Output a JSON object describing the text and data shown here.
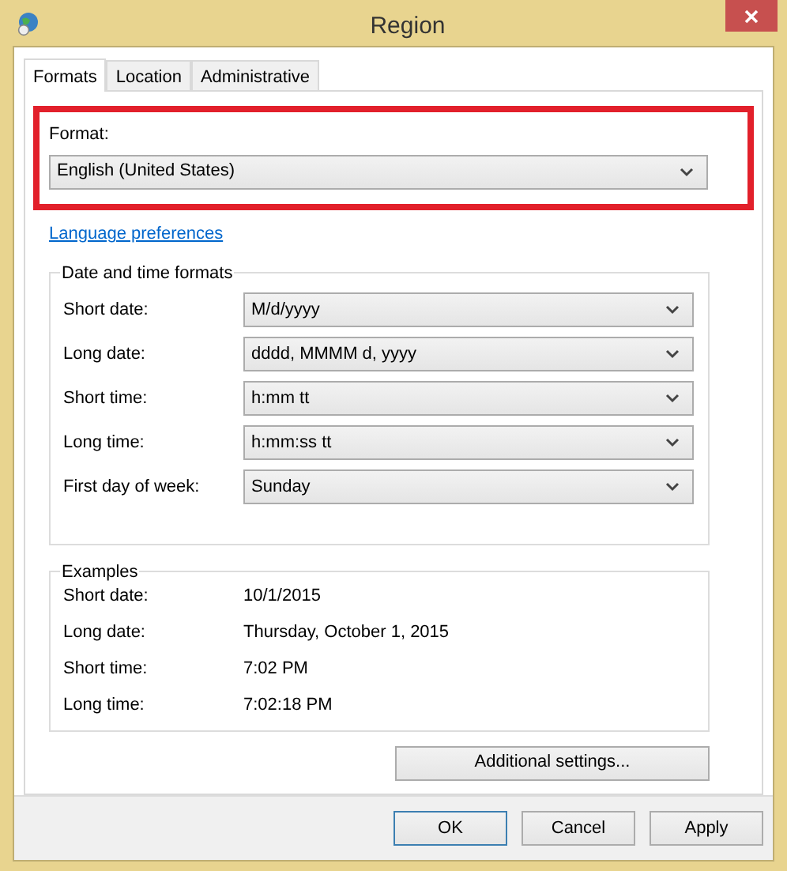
{
  "window": {
    "title": "Region"
  },
  "tabs": [
    {
      "label": "Formats",
      "selected": true
    },
    {
      "label": "Location",
      "selected": false
    },
    {
      "label": "Administrative",
      "selected": false
    }
  ],
  "format": {
    "label": "Format:",
    "value": "English (United States)"
  },
  "link": "Language preferences",
  "date_time_formats": {
    "title": "Date and time formats",
    "rows": [
      {
        "label": "Short date:",
        "value": "M/d/yyyy"
      },
      {
        "label": "Long date:",
        "value": "dddd, MMMM d, yyyy"
      },
      {
        "label": "Short time:",
        "value": "h:mm tt"
      },
      {
        "label": "Long time:",
        "value": "h:mm:ss tt"
      },
      {
        "label": "First day of week:",
        "value": "Sunday"
      }
    ]
  },
  "examples": {
    "title": "Examples",
    "rows": [
      {
        "label": "Short date:",
        "value": "10/1/2015"
      },
      {
        "label": "Long date:",
        "value": "Thursday, October 1, 2015"
      },
      {
        "label": "Short time:",
        "value": "7:02 PM"
      },
      {
        "label": "Long time:",
        "value": "7:02:18 PM"
      }
    ]
  },
  "additional_button": "Additional settings...",
  "buttons": [
    {
      "label": "OK",
      "default": true
    },
    {
      "label": "Cancel",
      "default": false
    },
    {
      "label": "Apply",
      "default": false
    }
  ]
}
